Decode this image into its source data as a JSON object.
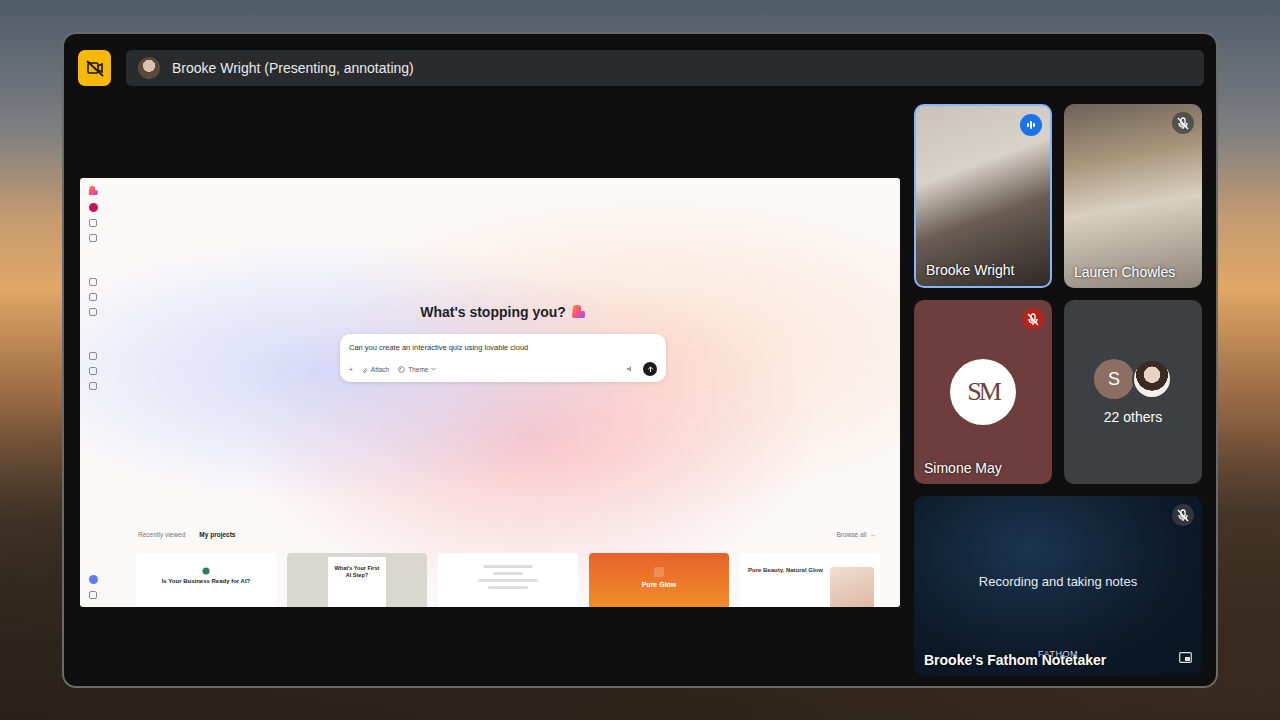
{
  "header": {
    "presenter": "Brooke Wright (Presenting, annotating)"
  },
  "shared_screen": {
    "heading": "What's stopping you?",
    "prompt": {
      "value": "Can you create an interactive quiz using lovable cloud",
      "add": "+",
      "buttons": [
        "Attach",
        "Theme"
      ]
    },
    "tabs": [
      {
        "label": "Recently viewed",
        "selected": false
      },
      {
        "label": "My projects",
        "selected": true
      }
    ],
    "browse": "Browse all",
    "browse_arrow": "→",
    "projects": [
      {
        "kind": "light",
        "title": "Is Your Business Ready for AI?"
      },
      {
        "kind": "panel",
        "title": "What's Your First AI Step?"
      },
      {
        "kind": "form"
      },
      {
        "kind": "orange",
        "title": "Pure Glow"
      },
      {
        "kind": "hero",
        "title": "Pure Beauty, Natural Glow"
      }
    ]
  },
  "participants": [
    {
      "name": "Brooke Wright",
      "kind": "video",
      "muted": false,
      "speaking": true
    },
    {
      "name": "Lauren Chowles",
      "kind": "video",
      "muted": true,
      "speaking": false
    },
    {
      "name": "Simone May",
      "kind": "logo",
      "logo": "SM",
      "muted": true,
      "speaking": false
    }
  ],
  "others": {
    "label": "22 others",
    "initial": "S"
  },
  "notetaker": {
    "name": "Brooke's Fathom Notetaker",
    "status": "Recording and taking notes",
    "brand": "FATHOM",
    "muted": true
  }
}
